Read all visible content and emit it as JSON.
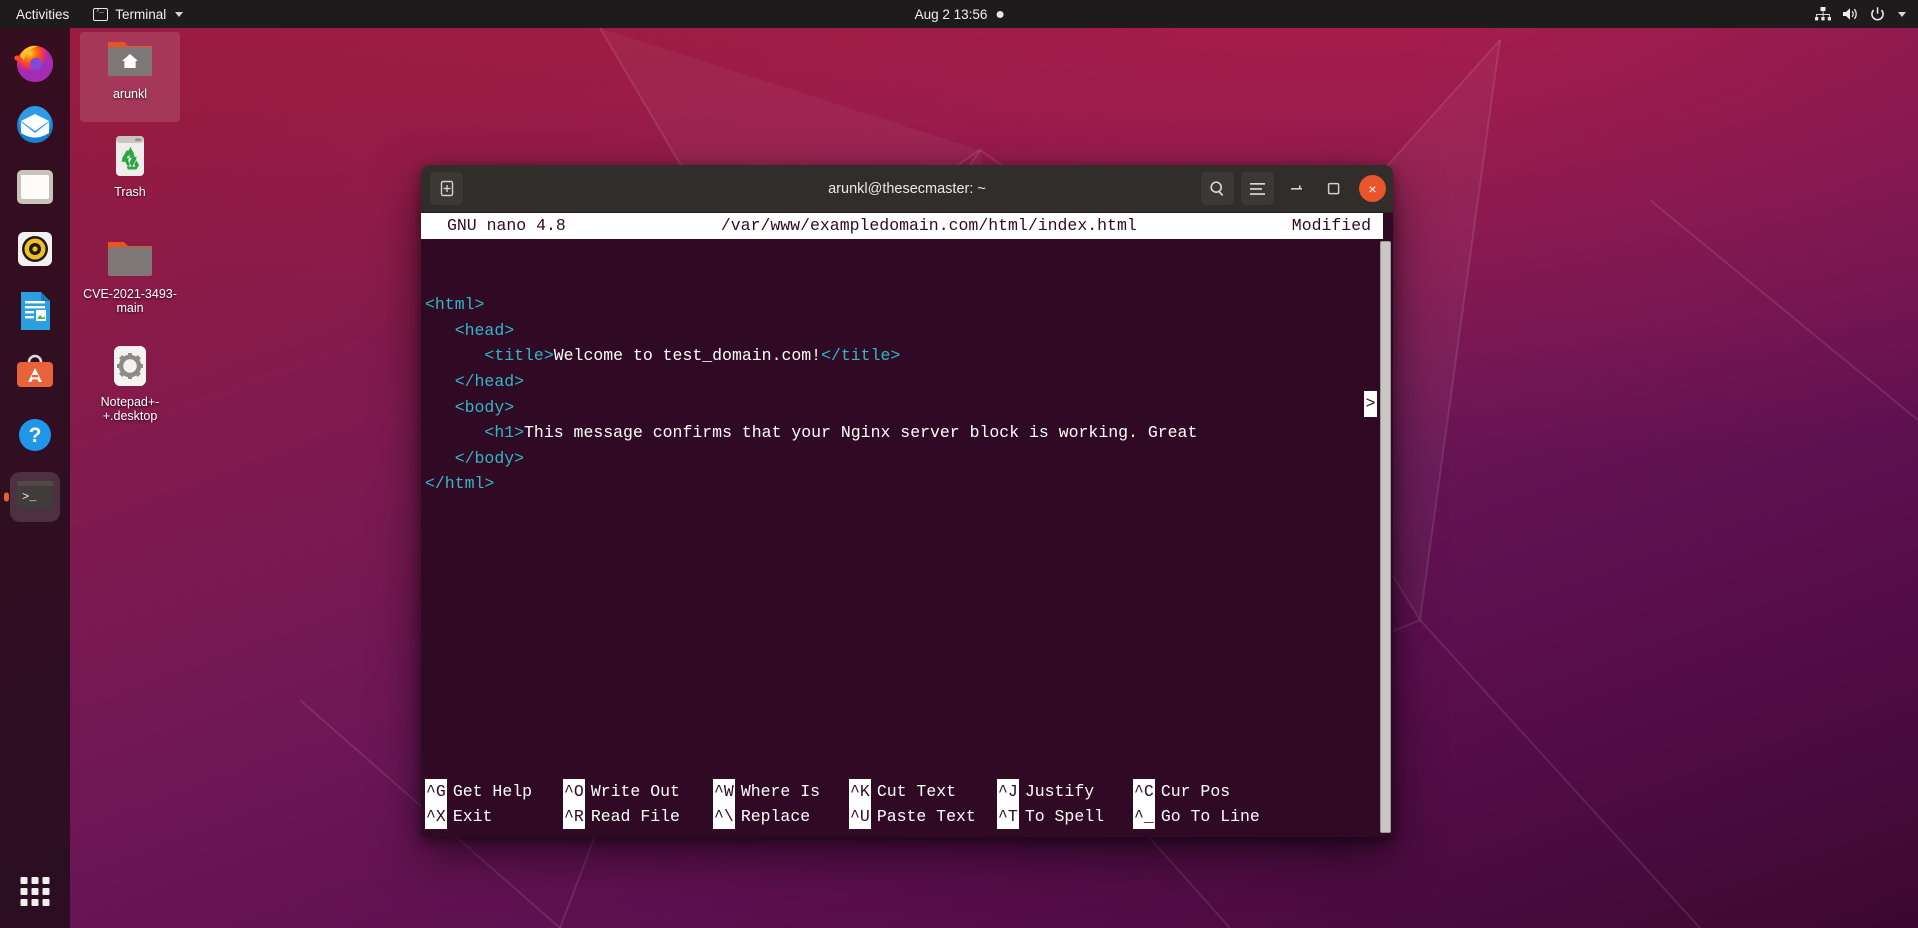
{
  "topbar": {
    "activities": "Activities",
    "app_menu": "Terminal",
    "app_icon": "terminal-icon",
    "clock": "Aug 2  13:56",
    "notification_dot": "notification-indicator",
    "tray_icons": [
      "network-icon",
      "volume-icon",
      "power-icon",
      "chevron-down-icon"
    ]
  },
  "dock": {
    "items": [
      {
        "name": "firefox",
        "label": "Firefox",
        "active": false
      },
      {
        "name": "thunderbird",
        "label": "Thunderbird Mail",
        "active": false
      },
      {
        "name": "files",
        "label": "Files",
        "active": false
      },
      {
        "name": "rhythmbox",
        "label": "Rhythmbox",
        "active": false
      },
      {
        "name": "libreoffice-writer",
        "label": "LibreOffice Writer",
        "active": false
      },
      {
        "name": "ubuntu-software",
        "label": "Ubuntu Software",
        "active": false
      },
      {
        "name": "help",
        "label": "Help",
        "active": false
      },
      {
        "name": "terminal",
        "label": "Terminal",
        "active": true
      }
    ],
    "show_apps_label": "Show Applications"
  },
  "desktop_icons": [
    {
      "label": "arunkl",
      "type": "home-folder",
      "selected": true
    },
    {
      "label": "Trash",
      "type": "trash",
      "selected": false
    },
    {
      "label": "CVE-2021-3493-main",
      "type": "folder",
      "selected": false
    },
    {
      "label": "Notepad+-+.desktop",
      "type": "desktop-file",
      "selected": false
    }
  ],
  "window": {
    "title": "arunkl@thesecmaster: ~",
    "new_tab_icon": "new-tab-icon",
    "search_icon": "search-icon",
    "menu_icon": "hamburger-menu-icon",
    "minimize_icon": "minimize-icon",
    "maximize_icon": "maximize-icon",
    "close_icon": "close-icon",
    "close_label": "×"
  },
  "nano": {
    "version": "GNU nano 4.8",
    "filepath": "/var/www/exampledomain.com/html/index.html",
    "status": "Modified",
    "continuation_marker": ">",
    "lines": [
      [
        {
          "t": "tag",
          "v": "<html>"
        }
      ],
      [
        {
          "t": "plain",
          "v": "   "
        },
        {
          "t": "tag",
          "v": "<head>"
        }
      ],
      [
        {
          "t": "plain",
          "v": "      "
        },
        {
          "t": "tag",
          "v": "<title>"
        },
        {
          "t": "plain",
          "v": "Welcome to test_domain.com!"
        },
        {
          "t": "tag",
          "v": "</title>"
        }
      ],
      [
        {
          "t": "plain",
          "v": "   "
        },
        {
          "t": "tag",
          "v": "</head>"
        }
      ],
      [
        {
          "t": "plain",
          "v": "   "
        },
        {
          "t": "tag",
          "v": "<body>"
        }
      ],
      [
        {
          "t": "plain",
          "v": "      "
        },
        {
          "t": "tag",
          "v": "<h1>"
        },
        {
          "t": "plain",
          "v": "This message confirms that your Nginx server block is working. Great "
        }
      ],
      [
        {
          "t": "plain",
          "v": "   "
        },
        {
          "t": "tag",
          "v": "</body>"
        }
      ],
      [
        {
          "t": "tag",
          "v": "</html>"
        }
      ]
    ],
    "shortcuts": [
      [
        {
          "key": "^G",
          "label": "Get Help"
        },
        {
          "key": "^X",
          "label": "Exit"
        }
      ],
      [
        {
          "key": "^O",
          "label": "Write Out"
        },
        {
          "key": "^R",
          "label": "Read File"
        }
      ],
      [
        {
          "key": "^W",
          "label": "Where Is"
        },
        {
          "key": "^\\",
          "label": "Replace"
        }
      ],
      [
        {
          "key": "^K",
          "label": "Cut Text"
        },
        {
          "key": "^U",
          "label": "Paste Text"
        }
      ],
      [
        {
          "key": "^J",
          "label": "Justify"
        },
        {
          "key": "^T",
          "label": "To Spell"
        }
      ],
      [
        {
          "key": "^C",
          "label": "Cur Pos"
        },
        {
          "key": "^_",
          "label": "Go To Line"
        }
      ]
    ]
  },
  "colors": {
    "nano_bg": "#300a24",
    "tag_cyan": "#2fb8c4",
    "close_orange": "#e9542a",
    "dock_active": "#e8602c",
    "titlebar": "#302d2b"
  }
}
